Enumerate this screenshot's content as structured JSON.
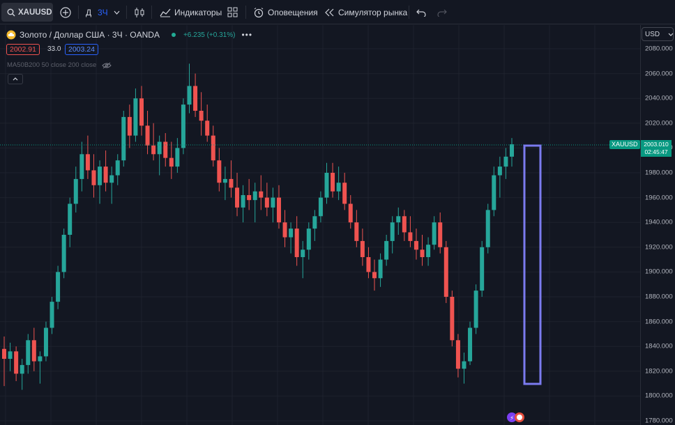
{
  "toolbar": {
    "symbol": "XAUUSD",
    "interval_d": "Д",
    "interval_active": "3Ч",
    "indicators_label": "Индикаторы",
    "alerts_label": "Оповещения",
    "replay_label": "Симулятор рынка"
  },
  "legend": {
    "title": "Золото / Доллар США · 3Ч · OANDA",
    "change": "+6.235 (+0.31%)",
    "sell_price": "2002.91",
    "spread": "33.0",
    "buy_price": "2003.24",
    "ma_label": "MA50B200 50 close 200 close"
  },
  "axis": {
    "currency": "USD",
    "ticks": [
      "2080.000",
      "2060.000",
      "2040.000",
      "2020.000",
      "2000.000",
      "1980.000",
      "1960.000",
      "1940.000",
      "1920.000",
      "1900.000",
      "1880.000",
      "1860.000",
      "1840.000",
      "1820.000",
      "1800.000",
      "1780.000"
    ]
  },
  "price_marker": {
    "symbol": "XAUUSD",
    "price": "2003.010",
    "countdown": "02:45:47"
  },
  "colors": {
    "background": "#131722",
    "up": "#26a69a",
    "down": "#ef5350",
    "highlight_box": "#7b7bf0",
    "accent": "#2962ff"
  },
  "chart_data": {
    "type": "candlestick",
    "series": [
      {
        "name": "XAUUSD",
        "values": [
          [
            1838,
            1848,
            1808,
            1830
          ],
          [
            1830,
            1843,
            1820,
            1836
          ],
          [
            1836,
            1840,
            1812,
            1818
          ],
          [
            1818,
            1830,
            1805,
            1825
          ],
          [
            1825,
            1850,
            1818,
            1845
          ],
          [
            1845,
            1855,
            1820,
            1828
          ],
          [
            1828,
            1836,
            1810,
            1832
          ],
          [
            1832,
            1860,
            1828,
            1855
          ],
          [
            1855,
            1880,
            1850,
            1876
          ],
          [
            1876,
            1905,
            1870,
            1900
          ],
          [
            1900,
            1935,
            1895,
            1930
          ],
          [
            1930,
            1960,
            1920,
            1955
          ],
          [
            1955,
            1985,
            1948,
            1975
          ],
          [
            1975,
            2005,
            1965,
            1995
          ],
          [
            1995,
            2010,
            1975,
            1982
          ],
          [
            1982,
            1995,
            1960,
            1970
          ],
          [
            1970,
            1990,
            1955,
            1985
          ],
          [
            1985,
            1998,
            1965,
            1972
          ],
          [
            1972,
            1985,
            1955,
            1978
          ],
          [
            1978,
            1995,
            1970,
            1990
          ],
          [
            1990,
            2030,
            1985,
            2025
          ],
          [
            2025,
            2035,
            2000,
            2010
          ],
          [
            2010,
            2048,
            2005,
            2040
          ],
          [
            2040,
            2050,
            2010,
            2018
          ],
          [
            2018,
            2030,
            1995,
            2002
          ],
          [
            2002,
            2020,
            1990,
            1995
          ],
          [
            1995,
            2010,
            1978,
            2005
          ],
          [
            2005,
            2012,
            1985,
            1992
          ],
          [
            1992,
            2005,
            1975,
            1985
          ],
          [
            1985,
            2008,
            1980,
            2000
          ],
          [
            2000,
            2040,
            1995,
            2035
          ],
          [
            2035,
            2068,
            2028,
            2050
          ],
          [
            2050,
            2060,
            2025,
            2030
          ],
          [
            2030,
            2045,
            2010,
            2022
          ],
          [
            2022,
            2035,
            2005,
            2010
          ],
          [
            2010,
            2018,
            1985,
            1990
          ],
          [
            1990,
            2000,
            1965,
            1972
          ],
          [
            1972,
            1985,
            1958,
            1975
          ],
          [
            1975,
            1990,
            1960,
            1968
          ],
          [
            1968,
            1980,
            1945,
            1952
          ],
          [
            1952,
            1970,
            1940,
            1962
          ],
          [
            1962,
            1975,
            1950,
            1958
          ],
          [
            1958,
            1972,
            1940,
            1965
          ],
          [
            1965,
            1978,
            1950,
            1960
          ],
          [
            1960,
            1972,
            1945,
            1952
          ],
          [
            1952,
            1968,
            1940,
            1960
          ],
          [
            1960,
            1970,
            1935,
            1940
          ],
          [
            1940,
            1950,
            1920,
            1928
          ],
          [
            1928,
            1940,
            1915,
            1935
          ],
          [
            1935,
            1945,
            1905,
            1912
          ],
          [
            1912,
            1925,
            1895,
            1918
          ],
          [
            1918,
            1940,
            1910,
            1935
          ],
          [
            1935,
            1950,
            1925,
            1945
          ],
          [
            1945,
            1965,
            1940,
            1960
          ],
          [
            1960,
            1988,
            1955,
            1980
          ],
          [
            1980,
            1988,
            1960,
            1965
          ],
          [
            1965,
            1985,
            1958,
            1972
          ],
          [
            1972,
            1980,
            1950,
            1955
          ],
          [
            1955,
            1962,
            1935,
            1940
          ],
          [
            1940,
            1950,
            1920,
            1925
          ],
          [
            1925,
            1935,
            1905,
            1912
          ],
          [
            1912,
            1920,
            1895,
            1900
          ],
          [
            1900,
            1910,
            1885,
            1895
          ],
          [
            1895,
            1915,
            1888,
            1910
          ],
          [
            1910,
            1930,
            1905,
            1925
          ],
          [
            1925,
            1945,
            1915,
            1940
          ],
          [
            1940,
            1952,
            1930,
            1945
          ],
          [
            1945,
            1950,
            1925,
            1932
          ],
          [
            1932,
            1945,
            1920,
            1925
          ],
          [
            1925,
            1935,
            1910,
            1918
          ],
          [
            1918,
            1930,
            1905,
            1912
          ],
          [
            1912,
            1928,
            1905,
            1922
          ],
          [
            1922,
            1945,
            1918,
            1940
          ],
          [
            1940,
            1948,
            1915,
            1920
          ],
          [
            1920,
            1925,
            1875,
            1880
          ],
          [
            1880,
            1885,
            1840,
            1845
          ],
          [
            1845,
            1850,
            1815,
            1822
          ],
          [
            1822,
            1835,
            1810,
            1828
          ],
          [
            1828,
            1860,
            1825,
            1855
          ],
          [
            1855,
            1890,
            1850,
            1885
          ],
          [
            1885,
            1925,
            1880,
            1920
          ],
          [
            1920,
            1955,
            1915,
            1950
          ],
          [
            1950,
            1985,
            1945,
            1978
          ],
          [
            1978,
            1993,
            1960,
            1985
          ],
          [
            1985,
            2000,
            1975,
            1993
          ],
          [
            1993,
            2008,
            1985,
            2003
          ]
        ]
      }
    ],
    "ylim": [
      1775,
      2085
    ],
    "grid": true
  }
}
